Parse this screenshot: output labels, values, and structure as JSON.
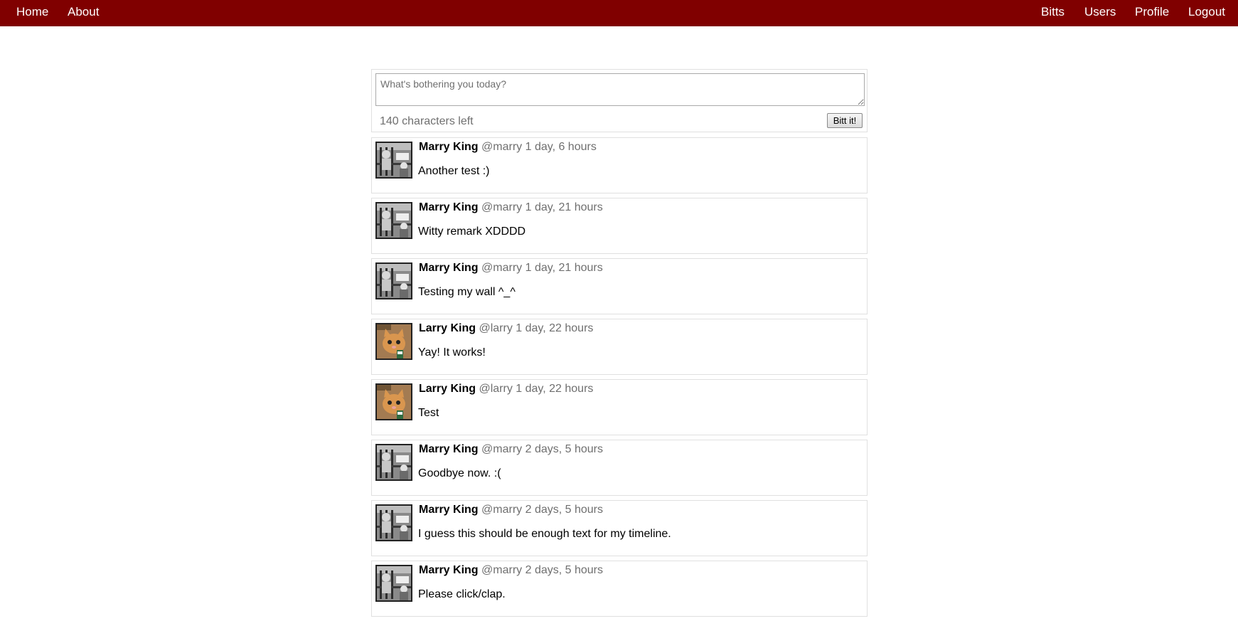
{
  "nav": {
    "left": [
      "Home",
      "About"
    ],
    "right": [
      "Bitts",
      "Users",
      "Profile",
      "Logout"
    ]
  },
  "compose": {
    "placeholder": "What's bothering you today?",
    "chars_left": "140 characters left",
    "submit_label": "Bitt it!"
  },
  "posts": [
    {
      "name": "Marry King",
      "handle": "@marry",
      "time": "1 day, 6 hours",
      "text": "Another test :)",
      "avatar": "marry"
    },
    {
      "name": "Marry King",
      "handle": "@marry",
      "time": "1 day, 21 hours",
      "text": "Witty remark XDDDD",
      "avatar": "marry"
    },
    {
      "name": "Marry King",
      "handle": "@marry",
      "time": "1 day, 21 hours",
      "text": "Testing my wall ^_^",
      "avatar": "marry"
    },
    {
      "name": "Larry King",
      "handle": "@larry",
      "time": "1 day, 22 hours",
      "text": "Yay! It works!",
      "avatar": "larry"
    },
    {
      "name": "Larry King",
      "handle": "@larry",
      "time": "1 day, 22 hours",
      "text": "Test",
      "avatar": "larry"
    },
    {
      "name": "Marry King",
      "handle": "@marry",
      "time": "2 days, 5 hours",
      "text": "Goodbye now. :(",
      "avatar": "marry"
    },
    {
      "name": "Marry King",
      "handle": "@marry",
      "time": "2 days, 5 hours",
      "text": "I guess this should be enough text for my timeline.",
      "avatar": "marry"
    },
    {
      "name": "Marry King",
      "handle": "@marry",
      "time": "2 days, 5 hours",
      "text": "Please click/clap.",
      "avatar": "marry"
    }
  ],
  "colors": {
    "navbar": "#800000",
    "muted": "#6f6f6f",
    "border": "#e0e0e0"
  }
}
